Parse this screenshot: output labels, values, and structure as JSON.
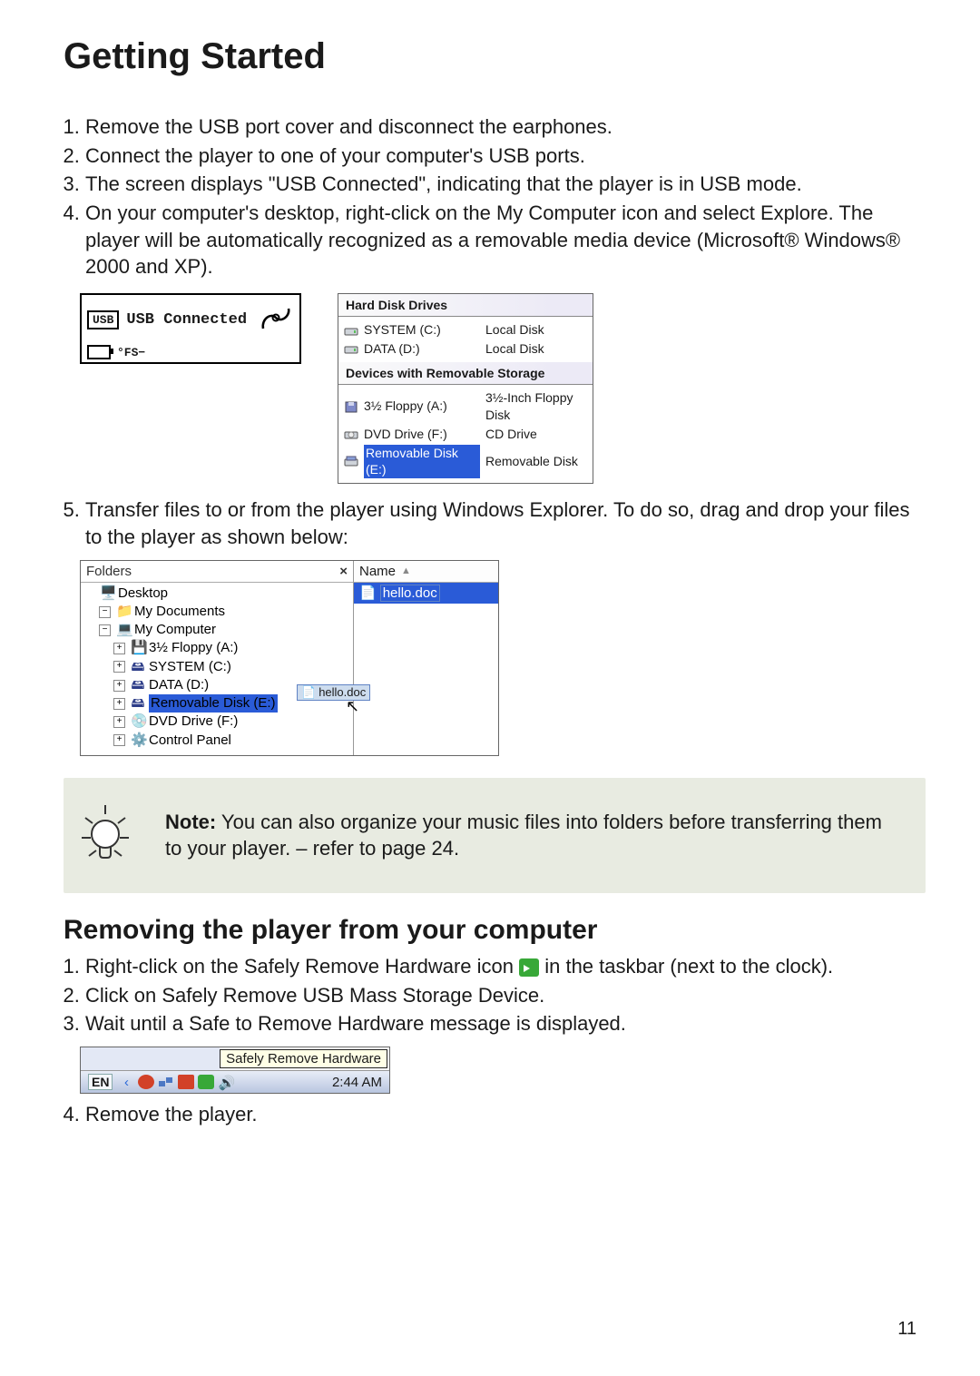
{
  "page": {
    "title": "Getting Started",
    "number": "11"
  },
  "steps": {
    "s1": "Remove the USB port cover and disconnect the earphones.",
    "s2": "Connect the player to one of your computer's USB ports.",
    "s3": "The screen displays \"USB Connected\", indicating that the player is in USB mode.",
    "s4": "On your computer's desktop, right-click on the My Computer icon and select Explore. The player will be automatically recognized as a removable media device (Microsoft® Windows® 2000 and XP).",
    "s5": "Transfer files to or from the player using Windows Explorer. To do so, drag and drop your files to the player as shown below:"
  },
  "lcd": {
    "usb_badge": "USB",
    "usb_text": "USB Connected",
    "fs": "°FS−"
  },
  "drives": {
    "group_hdd": "Hard Disk Drives",
    "group_rem": "Devices with Removable Storage",
    "rows": [
      {
        "label": "SYSTEM (C:)",
        "type": "Local Disk",
        "icon": "disk"
      },
      {
        "label": "DATA (D:)",
        "type": "Local Disk",
        "icon": "disk"
      }
    ],
    "rem_rows": [
      {
        "label": "3½ Floppy (A:)",
        "type": "3½-Inch Floppy Disk",
        "icon": "floppy"
      },
      {
        "label": "DVD Drive (F:)",
        "type": "CD Drive",
        "icon": "cd"
      },
      {
        "label": "Removable Disk (E:)",
        "type": "Removable Disk",
        "icon": "rem",
        "selected": true
      }
    ]
  },
  "explorer": {
    "folders_title": "Folders",
    "close": "×",
    "name_col": "Name",
    "tree": {
      "desktop": "Desktop",
      "mydocs": "My Documents",
      "mycomp": "My Computer",
      "floppy": "3½ Floppy (A:)",
      "systemc": "SYSTEM (C:)",
      "datad": "DATA (D:)",
      "removable": "Removable Disk (E:)",
      "dvd": "DVD Drive (F:)",
      "cpanel": "Control Panel"
    },
    "drag_file": "hello.doc",
    "file_row": "hello.doc"
  },
  "note": {
    "label": "Note:",
    "text": "  You can also organize your music files into folders before transferring them to your player. – refer to page 24."
  },
  "subsection": {
    "title": "Removing the player from your computer",
    "r1_a": "Right-click on the Safely Remove Hardware icon ",
    "r1_b": " in the taskbar (next to the clock).",
    "r2": "Click on Safely Remove USB Mass Storage Device.",
    "r3": "Wait until a Safe to Remove Hardware message is displayed.",
    "r4": "Remove the player."
  },
  "taskbar": {
    "tooltip": "Safely Remove Hardware",
    "lang": "EN",
    "time": "2:44 AM"
  }
}
